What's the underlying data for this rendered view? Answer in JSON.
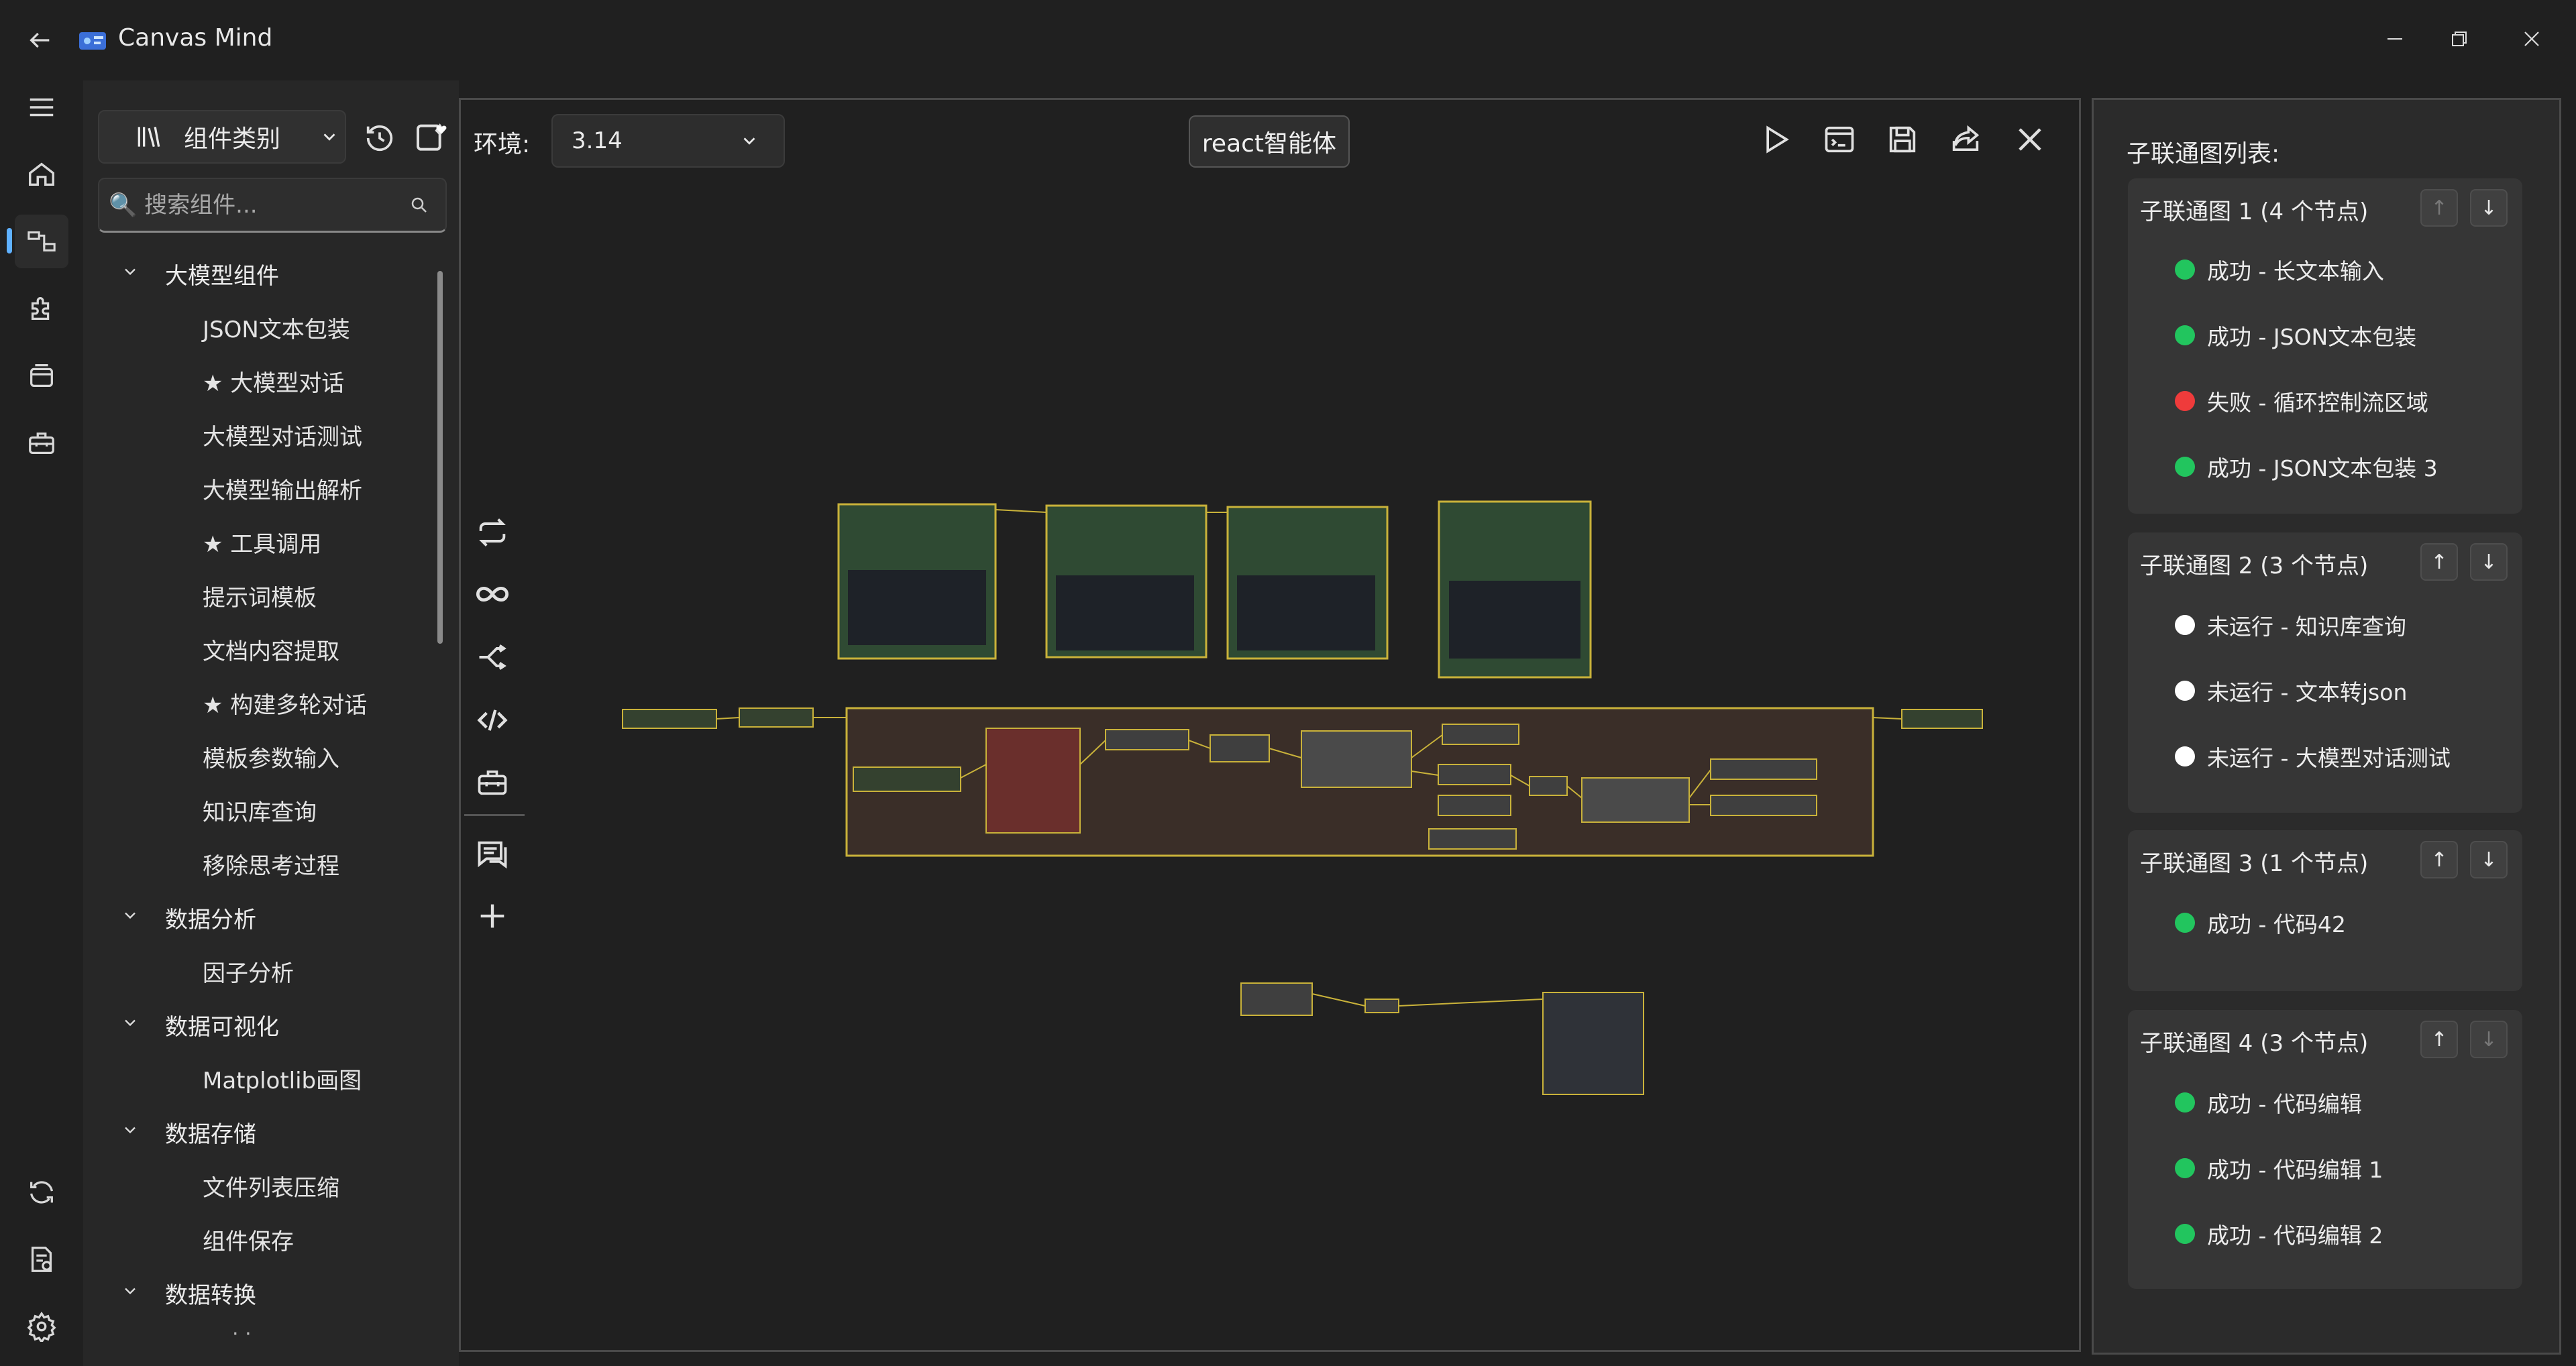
{
  "window": {
    "app_title": "Canvas Mind",
    "controls": [
      "minimize",
      "restore",
      "close"
    ]
  },
  "left_rail": {
    "items": [
      "menu-icon",
      "home-icon",
      "workflow-icon",
      "plugin-icon",
      "gallery-icon",
      "toolbox-icon"
    ],
    "bottom_items": [
      "sync-icon",
      "log-icon",
      "settings-icon"
    ],
    "active": "workflow-icon"
  },
  "component_panel": {
    "category_button": "组件类别",
    "search_placeholder": "🔍 搜索组件...",
    "tree": [
      {
        "label": "大模型组件",
        "children": [
          "JSON文本包装",
          "★ 大模型对话",
          "大模型对话测试",
          "大模型输出解析",
          "★ 工具调用",
          "提示词模板",
          "文档内容提取",
          "★ 构建多轮对话",
          "模板参数输入",
          "知识库查询",
          "移除思考过程"
        ]
      },
      {
        "label": "数据分析",
        "children": [
          "因子分析"
        ]
      },
      {
        "label": "数据可视化",
        "children": [
          "Matplotlib画图"
        ]
      },
      {
        "label": "数据存储",
        "children": [
          "文件列表压缩",
          "组件保存"
        ]
      },
      {
        "label": "数据转换",
        "children": []
      }
    ],
    "tree_trailing": "· ·"
  },
  "canvas": {
    "env_label": "环境:",
    "env_value": "3.14",
    "flow_title": "react智能体",
    "top_tools": [
      "run-icon",
      "terminal-icon",
      "save-icon",
      "share-icon",
      "close-icon"
    ],
    "side_tools": [
      "loop-icon",
      "infinity-icon",
      "branch-icon",
      "code-icon",
      "toolbox-icon",
      "chat-icon",
      "add-icon"
    ]
  },
  "subgraph_panel": {
    "title": "子联通图列表:",
    "status_colors": {
      "成功": "#22c55e",
      "失败": "#ef3b3b",
      "未运行": "#ffffff"
    },
    "groups": [
      {
        "title": "子联通图 1 (4 个节点)",
        "up_disabled": true,
        "down_disabled": false,
        "nodes": [
          {
            "status": "成功",
            "text": "成功 - 长文本输入"
          },
          {
            "status": "成功",
            "text": "成功 - JSON文本包装"
          },
          {
            "status": "失败",
            "text": "失败 - 循环控制流区域"
          },
          {
            "status": "成功",
            "text": "成功 - JSON文本包装 3"
          }
        ]
      },
      {
        "title": "子联通图 2 (3 个节点)",
        "up_disabled": false,
        "down_disabled": false,
        "nodes": [
          {
            "status": "未运行",
            "text": "未运行 - 知识库查询"
          },
          {
            "status": "未运行",
            "text": "未运行 - 文本转json"
          },
          {
            "status": "未运行",
            "text": "未运行 - 大模型对话测试"
          }
        ]
      },
      {
        "title": "子联通图 3 (1 个节点)",
        "up_disabled": false,
        "down_disabled": false,
        "nodes": [
          {
            "status": "成功",
            "text": "成功 - 代码42"
          }
        ]
      },
      {
        "title": "子联通图 4 (3 个节点)",
        "up_disabled": false,
        "down_disabled": true,
        "nodes": [
          {
            "status": "成功",
            "text": "成功 - 代码编辑"
          },
          {
            "status": "成功",
            "text": "成功 - 代码编辑 1"
          },
          {
            "status": "成功",
            "text": "成功 - 代码编辑 2"
          }
        ]
      }
    ],
    "arrow_up": "↑",
    "arrow_down": "↓"
  }
}
